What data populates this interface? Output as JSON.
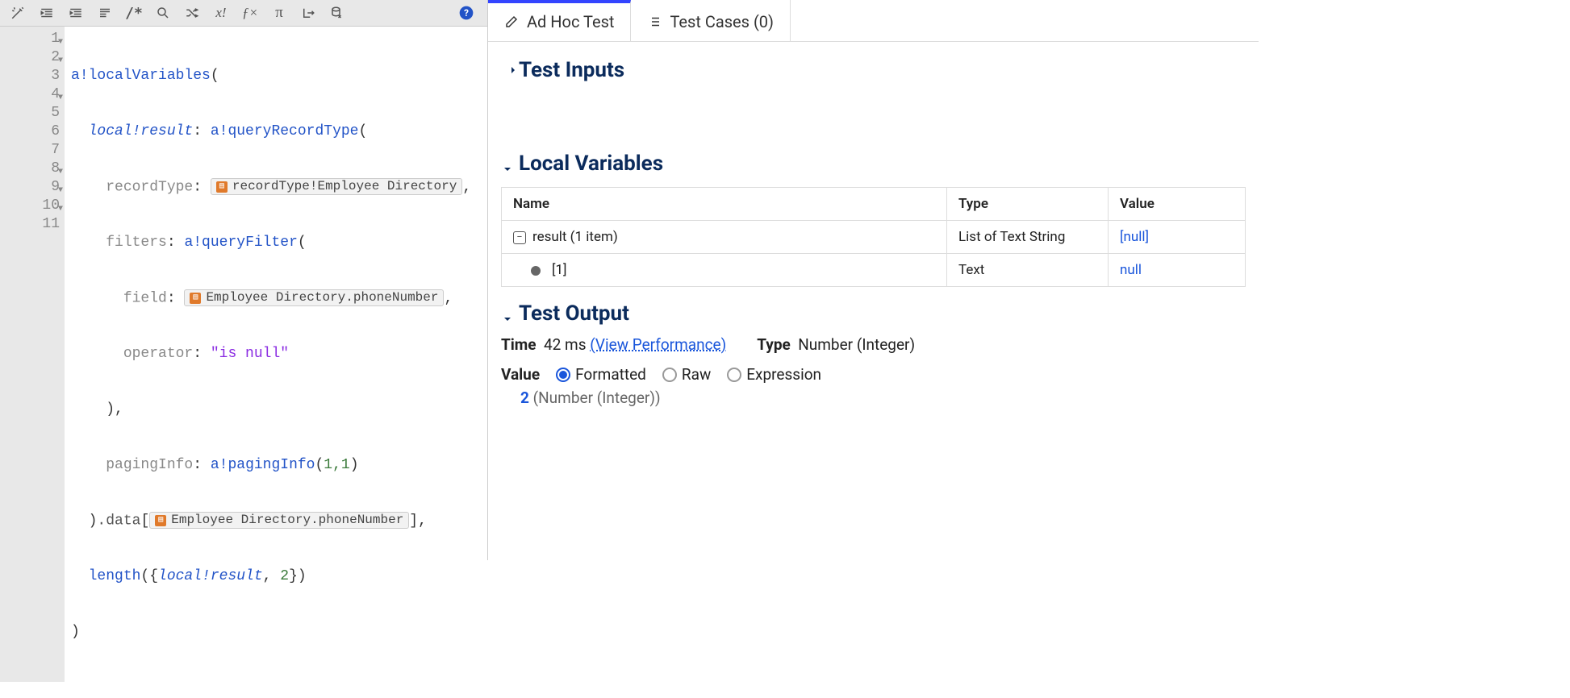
{
  "toolbar": {
    "icons": [
      "magic-wand",
      "outdent",
      "indent",
      "format",
      "comment",
      "search",
      "shuffle",
      "var-x",
      "fx",
      "pi",
      "export",
      "db"
    ],
    "help": "?"
  },
  "editor": {
    "lineCount": 11,
    "foldable": [
      1,
      2,
      4,
      8,
      9,
      10
    ],
    "code": {
      "l1_fn": "a!localVariables",
      "l2_local": "local!result",
      "l2_fn": "a!queryRecordType",
      "l3_param": "recordType",
      "l3_chip": "recordType!Employee Directory",
      "l4_param": "filters",
      "l4_fn": "a!queryFilter",
      "l5_param": "field",
      "l5_chip": "Employee Directory.phoneNumber",
      "l6_param": "operator",
      "l6_str": "\"is null\"",
      "l8_param": "pagingInfo",
      "l8_fn": "a!pagingInfo",
      "l8_args": "1,1",
      "l9_prop": ".data",
      "l9_chip": "Employee Directory.phoneNumber",
      "l10_fn": "length",
      "l10_var": "local!result",
      "l10_num": "2"
    }
  },
  "tabs": {
    "adhoc": "Ad Hoc Test",
    "cases": "Test Cases (0)"
  },
  "sections": {
    "inputs": "Test Inputs",
    "locals": "Local Variables",
    "output": "Test Output"
  },
  "localsTable": {
    "cols": {
      "name": "Name",
      "type": "Type",
      "value": "Value"
    },
    "rows": [
      {
        "name": "result (1 item)",
        "type": "List of Text String",
        "value": "[null]",
        "kind": "parent"
      },
      {
        "name": "[1]",
        "type": "Text",
        "value": "null",
        "kind": "child"
      }
    ]
  },
  "output": {
    "timeLabel": "Time",
    "time": "42 ms",
    "perfLink": "(View Performance)",
    "typeLabel": "Type",
    "type": "Number (Integer)",
    "valueLabel": "Value",
    "radios": {
      "formatted": "Formatted",
      "raw": "Raw",
      "expression": "Expression"
    },
    "result": {
      "value": "2",
      "typeText": "(Number (Integer))"
    }
  }
}
